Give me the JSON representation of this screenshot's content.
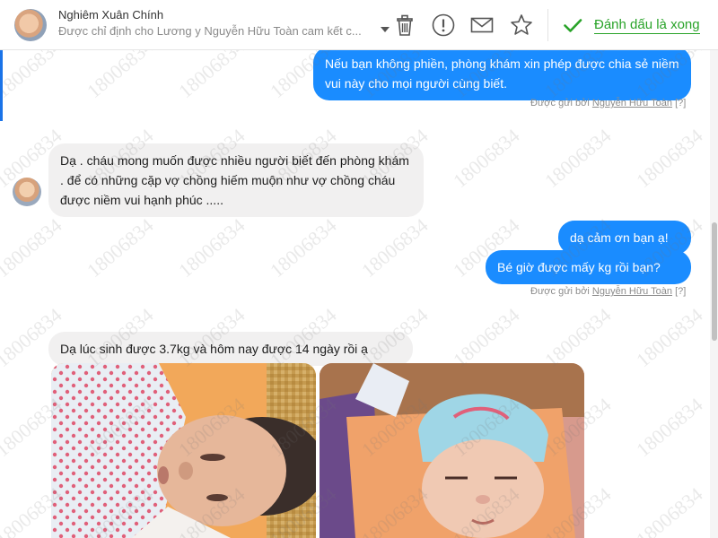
{
  "header": {
    "contact_name": "Nghiêm Xuân Chính",
    "contact_subtitle": "Được chỉ định cho Lương y Nguyễn Hữu Toàn cam kết c...",
    "done_label": "Đánh dấu là xong",
    "icons": [
      "trash-icon",
      "alert-icon",
      "mail-icon",
      "star-icon",
      "check-icon",
      "chevron-down-icon"
    ]
  },
  "watermark": "18006834",
  "messages": [
    {
      "direction": "outgoing",
      "text": "Nếu bạn không phiền, phòng khám xin phép được chia sẻ niềm vui này cho mọi người cùng biết."
    },
    {
      "direction": "incoming",
      "text": "Dạ . cháu mong muốn được nhiều người biết đến phòng khám . để có những cặp vợ chồng hiếm muộn như vợ chồng cháu được niềm vui hạnh phúc ....."
    },
    {
      "direction": "outgoing",
      "text": "dạ cảm ơn bạn ạ!"
    },
    {
      "direction": "outgoing",
      "text": "Bé giờ được mấy kg rồi bạn?"
    },
    {
      "direction": "incoming",
      "text": "Dạ lúc sinh được 3.7kg và hôm nay được 14 ngày rồi ạ"
    }
  ],
  "sent_by": {
    "prefix": "Được gửi bởi",
    "name": "Nguyễn Hữu Toàn",
    "help": "[?]"
  },
  "colors": {
    "outgoing_bubble": "#1a8cff",
    "incoming_bubble": "#f1f0f0",
    "done_green": "#29a329",
    "accent_blue": "#1a73e8"
  }
}
